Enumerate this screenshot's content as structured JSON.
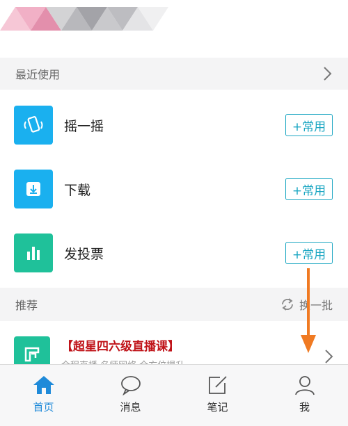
{
  "colors": {
    "accent": "#1aa6c2",
    "active_tab": "#1f8ad9",
    "promo_red": "#c0141a",
    "annotation_arrow": "#f07a22"
  },
  "recent": {
    "header": "最近使用",
    "items": [
      {
        "label": "摇一摇",
        "icon": "shake-phone-icon",
        "color": "#1ab0ef",
        "button": "+常用"
      },
      {
        "label": "下载",
        "icon": "download-icon",
        "color": "#1ab0ef",
        "button": "+常用"
      },
      {
        "label": "发投票",
        "icon": "bar-chart-icon",
        "color": "#1fc19a",
        "button": "+常用"
      }
    ]
  },
  "recommend": {
    "header": "推荐",
    "refresh_label": "换一批",
    "item": {
      "title": "【超星四六级直播课】",
      "subtitle": "全程直播 名师网络 全方位提升"
    }
  },
  "tabbar": {
    "items": [
      {
        "label": "首页",
        "icon": "home-icon",
        "active": true
      },
      {
        "label": "消息",
        "icon": "message-bubble-icon",
        "active": false
      },
      {
        "label": "笔记",
        "icon": "note-edit-icon",
        "active": false
      },
      {
        "label": "我",
        "icon": "person-icon",
        "active": false
      }
    ]
  }
}
